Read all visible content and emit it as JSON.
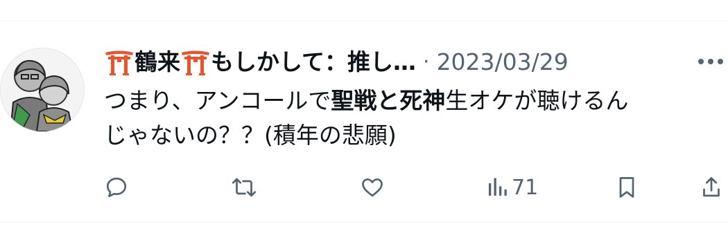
{
  "tweet": {
    "display_name_part1": "鶴来",
    "display_name_part2": "もしかして：推し…",
    "separator": "·",
    "timestamp": "2023/03/29",
    "body": {
      "line1_a": "つまり、アンコールで",
      "line1_bold": "聖戦と死神",
      "line1_b": "生オケが聴けるん",
      "line2": "じゃないの？？(積年の悲願)"
    }
  },
  "actions": {
    "views_count": "71"
  },
  "icons": {
    "header": [
      "torii-icon",
      "torii-icon",
      "more-icon"
    ],
    "actions": [
      "reply-icon",
      "retweet-icon",
      "like-icon",
      "views-icon",
      "bookmark-icon",
      "share-icon"
    ]
  },
  "colors": {
    "text_primary": "#0f1419",
    "text_secondary": "#536471",
    "torii_red": "#e8542b",
    "divider": "#eff3f4"
  }
}
